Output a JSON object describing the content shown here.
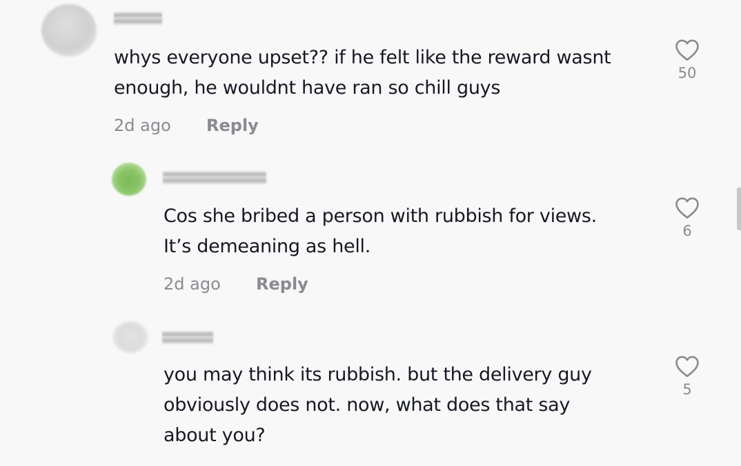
{
  "comments": [
    {
      "text_lines": [
        "whys everyone upset?? if he felt like the reward wasnt",
        "enough, he wouldnt have ran so chill guys"
      ],
      "time": "2d ago",
      "reply_label": "Reply",
      "likes": "50"
    },
    {
      "text_lines": [
        "Cos she bribed a person with rubbish for views.",
        "It’s demeaning as hell."
      ],
      "time": "2d ago",
      "reply_label": "Reply",
      "likes": "6"
    },
    {
      "text_lines": [
        "you may think its rubbish. but the delivery guy",
        "obviously does not. now, what does that say",
        "about you?"
      ],
      "likes": "5"
    }
  ],
  "icons": {
    "like": "heart-outline-icon"
  },
  "colors": {
    "background": "#f8f8f8",
    "text": "#161823",
    "secondary": "#8a8b91",
    "reply_avatar_green": "#79b857"
  }
}
